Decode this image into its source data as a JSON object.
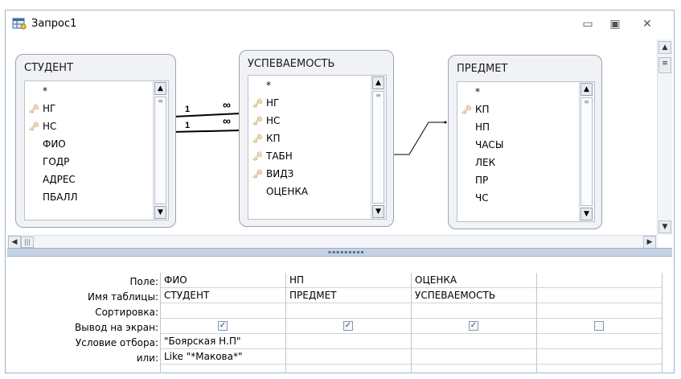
{
  "window": {
    "title": "Запрос1",
    "min_icon": "minimize-icon",
    "max_icon": "maximize-icon",
    "close_icon": "close-icon"
  },
  "tables": [
    {
      "name": "СТУДЕНТ",
      "fields": [
        {
          "name": "*",
          "key": false
        },
        {
          "name": "НГ",
          "key": true
        },
        {
          "name": "НС",
          "key": true
        },
        {
          "name": "ФИО",
          "key": false
        },
        {
          "name": "ГОДР",
          "key": false
        },
        {
          "name": "АДРЕС",
          "key": false
        },
        {
          "name": "ПБАЛЛ",
          "key": false
        }
      ]
    },
    {
      "name": "УСПЕВАЕМОСТЬ",
      "fields": [
        {
          "name": "*",
          "key": false
        },
        {
          "name": "НГ",
          "key": true
        },
        {
          "name": "НС",
          "key": true
        },
        {
          "name": "КП",
          "key": true
        },
        {
          "name": "ТАБН",
          "key": true
        },
        {
          "name": "ВИДЗ",
          "key": true
        },
        {
          "name": "ОЦЕНКА",
          "key": false
        }
      ]
    },
    {
      "name": "ПРЕДМЕТ",
      "fields": [
        {
          "name": "*",
          "key": false
        },
        {
          "name": "КП",
          "key": true
        },
        {
          "name": "НП",
          "key": false
        },
        {
          "name": "ЧАСЫ",
          "key": false
        },
        {
          "name": "ЛЕК",
          "key": false
        },
        {
          "name": "ПР",
          "key": false
        },
        {
          "name": "ЧС",
          "key": false
        }
      ]
    }
  ],
  "relations": {
    "one_label": "1",
    "many_label": "∞"
  },
  "grid": {
    "row_labels": {
      "field": "Поле:",
      "table": "Имя таблицы:",
      "sort": "Сортировка:",
      "show": "Вывод на экран:",
      "criteria": "Условие отбора:",
      "or": "или:"
    },
    "columns": [
      {
        "field": "ФИО",
        "table": "СТУДЕНТ",
        "sort": "",
        "show": true,
        "criteria": "\"Боярская Н.П\"",
        "or": "Like \"*Макова*\""
      },
      {
        "field": "НП",
        "table": "ПРЕДМЕТ",
        "sort": "",
        "show": true,
        "criteria": "",
        "or": ""
      },
      {
        "field": "ОЦЕНКА",
        "table": "УСПЕВАЕМОСТЬ",
        "sort": "",
        "show": true,
        "criteria": "",
        "or": ""
      },
      {
        "field": "",
        "table": "",
        "sort": "",
        "show": false,
        "criteria": "",
        "or": ""
      }
    ]
  },
  "icons": {
    "key": "key-icon",
    "query": "query-design-icon"
  }
}
